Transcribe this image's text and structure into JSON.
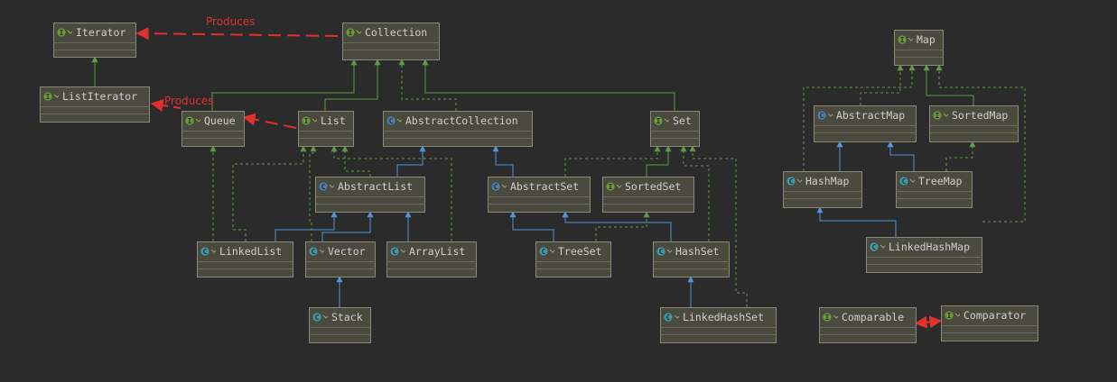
{
  "colors": {
    "background": "#2b2b2b",
    "box_fill": "#4a4a3f",
    "box_border": "#8a8a7a",
    "interface_badge": "#6b9a3a",
    "class_badge": "#3e9aa6",
    "abstract_badge": "#4a7fb0",
    "implements_line": "#5f9b45",
    "extends_line": "#5592d6",
    "relation_line": "#e03030"
  },
  "nodes": [
    {
      "id": "Iterator",
      "label": "Iterator",
      "kind": "interface"
    },
    {
      "id": "ListIterator",
      "label": "ListIterator",
      "kind": "interface"
    },
    {
      "id": "Collection",
      "label": "Collection",
      "kind": "interface"
    },
    {
      "id": "Queue",
      "label": "Queue",
      "kind": "interface"
    },
    {
      "id": "List",
      "label": "List",
      "kind": "interface"
    },
    {
      "id": "AbstractCollection",
      "label": "AbstractCollection",
      "kind": "abstract"
    },
    {
      "id": "Set",
      "label": "Set",
      "kind": "interface"
    },
    {
      "id": "AbstractList",
      "label": "AbstractList",
      "kind": "abstract"
    },
    {
      "id": "AbstractSet",
      "label": "AbstractSet",
      "kind": "abstract"
    },
    {
      "id": "SortedSet",
      "label": "SortedSet",
      "kind": "interface"
    },
    {
      "id": "LinkedList",
      "label": "LinkedList",
      "kind": "class"
    },
    {
      "id": "Vector",
      "label": "Vector",
      "kind": "class"
    },
    {
      "id": "ArrayList",
      "label": "ArrayList",
      "kind": "class"
    },
    {
      "id": "TreeSet",
      "label": "TreeSet",
      "kind": "class"
    },
    {
      "id": "HashSet",
      "label": "HashSet",
      "kind": "class"
    },
    {
      "id": "Stack",
      "label": "Stack",
      "kind": "class"
    },
    {
      "id": "LinkedHashSet",
      "label": "LinkedHashSet",
      "kind": "class"
    },
    {
      "id": "Map",
      "label": "Map",
      "kind": "interface"
    },
    {
      "id": "AbstractMap",
      "label": "AbstractMap",
      "kind": "abstract"
    },
    {
      "id": "SortedMap",
      "label": "SortedMap",
      "kind": "interface"
    },
    {
      "id": "HashMap",
      "label": "HashMap",
      "kind": "class"
    },
    {
      "id": "TreeMap",
      "label": "TreeMap",
      "kind": "class"
    },
    {
      "id": "LinkedHashMap",
      "label": "LinkedHashMap",
      "kind": "class"
    },
    {
      "id": "Comparable",
      "label": "Comparable",
      "kind": "interface"
    },
    {
      "id": "Comparator",
      "label": "Comparator",
      "kind": "interface"
    }
  ],
  "relations": [
    {
      "from": "Collection",
      "to": "Iterator",
      "label": "Produces"
    },
    {
      "from": "Queue",
      "to": "ListIterator",
      "label": "Produces"
    },
    {
      "from": "Comparable",
      "to": "Comparator",
      "label": ""
    }
  ]
}
